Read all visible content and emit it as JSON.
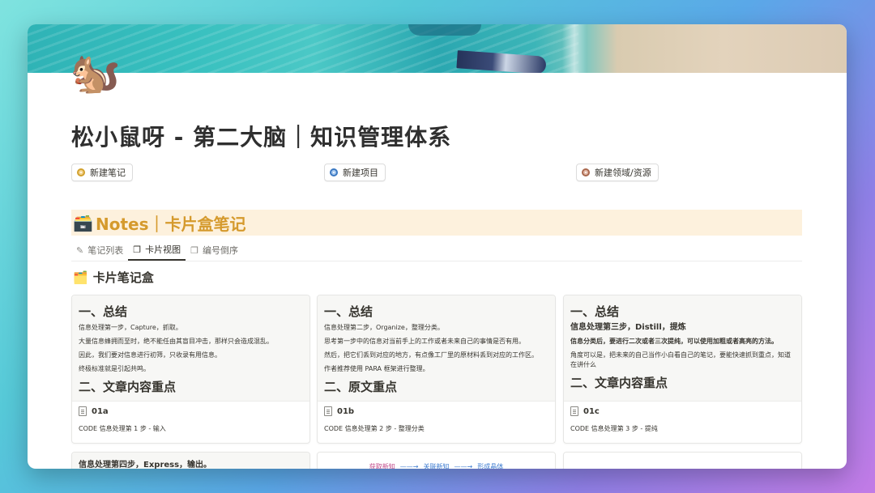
{
  "page": {
    "icon": "🐿️",
    "title": "松小鼠呀 - 第二大脑｜知识管理体系"
  },
  "buttons": [
    {
      "label": "新建笔记",
      "icon": "circle-icon"
    },
    {
      "label": "新建项目",
      "icon": "circle-icon"
    },
    {
      "label": "新建领域/资源",
      "icon": "circle-icon"
    }
  ],
  "section": {
    "icon": "🗃️",
    "title": "Notes｜卡片盒笔记"
  },
  "tabs": [
    {
      "label": "笔记列表",
      "icon": "✎",
      "active": false
    },
    {
      "label": "卡片视图",
      "icon": "❐",
      "active": true
    },
    {
      "label": "编号倒序",
      "icon": "❐",
      "active": false
    }
  ],
  "view": {
    "icon": "🗂️",
    "title": "卡片笔记盒"
  },
  "cards": [
    {
      "heading1": "一、总结",
      "lines": [
        {
          "text": "信息处理第一步，Capture，抓取。",
          "bold": false
        },
        {
          "text": "大量信息蜂拥而至时，绝不能任由其盲目冲击，那样只会造成混乱。",
          "bold": false
        },
        {
          "text": "因此，我们要对信息进行初筛，只收录有用信息。",
          "bold": false
        },
        {
          "text": "终极标准就是引起共鸣。",
          "bold": false
        }
      ],
      "heading2": "二、文章内容重点",
      "id": "01a",
      "code": "CODE 信息处理第 1 步 - 输入"
    },
    {
      "heading1": "一、总结",
      "lines": [
        {
          "text": "信息处理第二步，Organize，整理分类。",
          "bold": false
        },
        {
          "text": "思考第一步中的信息对当前手上的工作或者未来自己的事情是否有用。",
          "bold": false
        },
        {
          "text": "然后，把它们丢到对应的地方，有点像工厂里的原材料丢到对应的工作区。",
          "bold": false
        },
        {
          "text": "作者推荐使用 PARA 框架进行整理。",
          "bold": false
        }
      ],
      "heading2": "二、原文重点",
      "id": "01b",
      "code": "CODE 信息处理第 2 步 - 整理分类"
    },
    {
      "heading1": "一、总结",
      "lines": [
        {
          "text": "信息处理第三步，Distill，提炼",
          "bold": true
        },
        {
          "text": "信息分类后，要进行二次或者三次提纯，可以使用加粗或者高亮的方法。",
          "bold": true
        },
        {
          "text": "角度可以是，把未来的自己当作小白看自己的笔记，要能快速抓到重点，知道在讲什么",
          "bold": false
        }
      ],
      "heading2": "二、文章内容重点",
      "id": "01c",
      "code": "CODE 信息处理第 3 步 - 提纯"
    }
  ],
  "cards_row2": [
    {
      "text": "信息处理第四步，Express，输出。"
    },
    {
      "flow": [
        "获取新知",
        "关联新知",
        "形成晶体"
      ]
    },
    {
      "text": ""
    }
  ]
}
